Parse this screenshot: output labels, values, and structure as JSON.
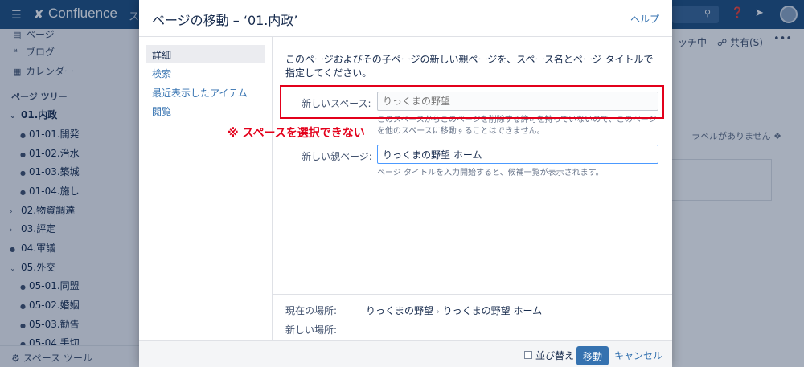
{
  "header": {
    "app_name": "Confluence",
    "trunc_text": "ス",
    "icons": [
      "menu-icon",
      "confluence-logo-icon",
      "search-icon",
      "help-icon",
      "notifications-icon",
      "avatar"
    ]
  },
  "sidebar": {
    "items": [
      {
        "icon": "page-icon",
        "label": "ページ"
      },
      {
        "icon": "blog-icon",
        "label": "ブログ"
      },
      {
        "icon": "calendar-icon",
        "label": "カレンダー"
      }
    ],
    "tree_heading": "ページ ツリー",
    "tree": [
      {
        "label": "01.内政",
        "type": "expanded",
        "bold": true
      },
      {
        "label": "01-01.開発",
        "type": "leaf"
      },
      {
        "label": "01-02.治水",
        "type": "leaf"
      },
      {
        "label": "01-03.築城",
        "type": "leaf"
      },
      {
        "label": "01-04.施し",
        "type": "leaf"
      },
      {
        "label": "02.物資調達",
        "type": "collapsed"
      },
      {
        "label": "03.評定",
        "type": "collapsed"
      },
      {
        "label": "04.軍議",
        "type": "leaf"
      },
      {
        "label": "05.外交",
        "type": "expanded"
      },
      {
        "label": "05-01.同盟",
        "type": "leaf"
      },
      {
        "label": "05-02.婚姻",
        "type": "leaf"
      },
      {
        "label": "05-03.勧告",
        "type": "leaf"
      },
      {
        "label": "05-04.手切",
        "type": "leaf"
      }
    ],
    "space_tools": "スペース ツール"
  },
  "background_page": {
    "watch": "ッチ中",
    "share": "共有(S)",
    "more": "•••",
    "labels": "ラベルがありません"
  },
  "dialog": {
    "title": "ページの移動 – ‘01.内政’",
    "help": "ヘルプ",
    "nav": [
      "詳細",
      "検索",
      "最近表示したアイテム",
      "閲覧"
    ],
    "description": "このページおよびその子ページの新しい親ページを、スペース名とページ タイトルで指定してください。",
    "space_label": "新しいスペース:",
    "space_value": "りっくまの野望",
    "space_hint": "このスペースからこのページを削除する許可を持っていないので、このページを他のスペースに移動することはできません。",
    "parent_label": "新しい親ページ:",
    "parent_value": "りっくまの野望 ホーム",
    "parent_hint": "ページ タイトルを入力開始すると、候補一覧が表示されます。",
    "current_location_label": "現在の場所:",
    "current_location_space": "りっくまの野望",
    "current_location_separator": "›",
    "current_location_page": "りっくまの野望 ホーム",
    "new_location_label": "新しい場所:",
    "reorder_label": "並び替え",
    "move_button": "移動",
    "cancel_button": "キャンセル"
  },
  "annotation": {
    "note": "※ スペースを選択できない",
    "color": "#e3001b"
  }
}
